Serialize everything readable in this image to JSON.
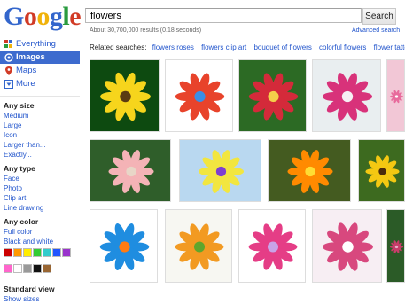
{
  "logo": {
    "letters": [
      "G",
      "o",
      "o",
      "g",
      "l",
      "e"
    ],
    "colors": [
      "#3366cc",
      "#d13b26",
      "#f0b20a",
      "#3366cc",
      "#2a9b3f",
      "#d13b26"
    ]
  },
  "search": {
    "query": "flowers",
    "button_label": "Search"
  },
  "stats": {
    "results_text": "About 30,700,000 results (0.18 seconds)",
    "advanced_label": "Advanced search"
  },
  "related": {
    "label": "Related searches:",
    "links": [
      "flowers roses",
      "flowers clip art",
      "bouquet of flowers",
      "colorful flowers",
      "flower tattoos"
    ]
  },
  "nav": {
    "items": [
      {
        "label": "Everything",
        "icon": "everything-icon"
      },
      {
        "label": "Images",
        "icon": "images-icon",
        "active": true
      },
      {
        "label": "Maps",
        "icon": "maps-icon"
      },
      {
        "label": "More",
        "icon": "more-icon"
      }
    ]
  },
  "filters": {
    "size": {
      "title": "Any size",
      "options": [
        "Medium",
        "Large",
        "Icon",
        "Larger than...",
        "Exactly..."
      ]
    },
    "type": {
      "title": "Any type",
      "options": [
        "Face",
        "Photo",
        "Clip art",
        "Line drawing"
      ]
    },
    "color": {
      "title": "Any color",
      "options": [
        "Full color",
        "Black and white"
      ],
      "swatches": [
        "#cc0000",
        "#ff9900",
        "#ffee00",
        "#33cc33",
        "#33cccc",
        "#2255ff",
        "#9933cc",
        "#ff66cc",
        "#ffffff",
        "#999999",
        "#111111",
        "#996633"
      ]
    },
    "view": {
      "title": "Standard view",
      "options": [
        "Show sizes"
      ]
    }
  },
  "images": [
    {
      "name": "yellow-daisy",
      "bg": "#0d4a10",
      "petal": "#f6d51c",
      "center": "#5a3b12"
    },
    {
      "name": "colorful-clipart",
      "bg": "#ffffff",
      "petal": "#e8432b",
      "center": "#3a8ee6"
    },
    {
      "name": "red-pink-bouquet",
      "bg": "#2c6a24",
      "petal": "#d42a3a",
      "center": "#f4d04a"
    },
    {
      "name": "pink-orchid",
      "bg": "#e9eef0",
      "petal": "#d8327a",
      "center": "#f6f0f4"
    },
    {
      "name": "pink-edge",
      "bg": "#f2c7d6",
      "petal": "#e86b9c",
      "center": "#fff"
    },
    {
      "name": "pink-dahlias",
      "bg": "#2f5e2a",
      "petal": "#f4b3b6",
      "center": "#e8d6c7"
    },
    {
      "name": "watercolor-meadow",
      "bg": "#b9d8f0",
      "petal": "#f2e640",
      "center": "#7e3fd0"
    },
    {
      "name": "flower-collage",
      "bg": "#445b20",
      "petal": "#ff8a00",
      "center": "#ffdd33"
    },
    {
      "name": "yellow-field",
      "bg": "#3d6a1f",
      "petal": "#f4c812",
      "center": "#4a2b0c"
    },
    {
      "name": "clipart-splash",
      "bg": "#ffffff",
      "petal": "#1f8de0",
      "center": "#ff7b12"
    },
    {
      "name": "orange-tulips",
      "bg": "#f7f7f2",
      "petal": "#f29a22",
      "center": "#5fa62c"
    },
    {
      "name": "pink-vase-bouquet",
      "bg": "#ffffff",
      "petal": "#e53d86",
      "center": "#c9a3e8"
    },
    {
      "name": "pink-roses-white",
      "bg": "#f7eef3",
      "petal": "#d8487e",
      "center": "#ffffff"
    },
    {
      "name": "pink-roses-dark",
      "bg": "#2b5b27",
      "petal": "#c73d6a",
      "center": "#e6b0c8"
    }
  ]
}
